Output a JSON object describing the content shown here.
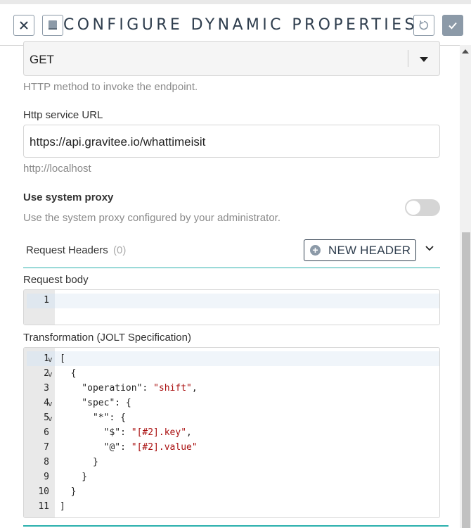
{
  "header": {
    "title": "CONFIGURE DYNAMIC PROPERTIES",
    "close_icon": "close-icon",
    "toggle_icon": "panel-icon",
    "reset_icon": "reset-icon",
    "confirm_icon": "check-icon"
  },
  "http_method": {
    "value": "GET",
    "hint": "HTTP method to invoke the endpoint."
  },
  "url": {
    "label": "Http service URL",
    "value": "https://api.gravitee.io/whattimeisit",
    "hint": "http://localhost"
  },
  "proxy": {
    "label": "Use system proxy",
    "hint": "Use the system proxy configured by your administrator.",
    "enabled": false
  },
  "request_headers": {
    "label": "Request Headers",
    "count": "(0)",
    "new_button": "NEW HEADER"
  },
  "request_body": {
    "label": "Request body",
    "lines": [
      "1"
    ]
  },
  "transformation": {
    "label": "Transformation (JOLT Specification)",
    "line_numbers": [
      "1",
      "2",
      "3",
      "4",
      "5",
      "6",
      "7",
      "8",
      "9",
      "10",
      "11"
    ],
    "code": {
      "l1": "[",
      "l2": "  {",
      "l3_key": "    \"operation\": ",
      "l3_val": "\"shift\"",
      "l3_end": ",",
      "l4": "    \"spec\": {",
      "l5": "      \"*\": {",
      "l6_key": "        \"$\": ",
      "l6_val": "\"[#2].key\"",
      "l6_end": ",",
      "l7_key": "        \"@\": ",
      "l7_val": "\"[#2].value\"",
      "l8": "      }",
      "l9": "    }",
      "l10": "  }",
      "l11": "]"
    }
  }
}
